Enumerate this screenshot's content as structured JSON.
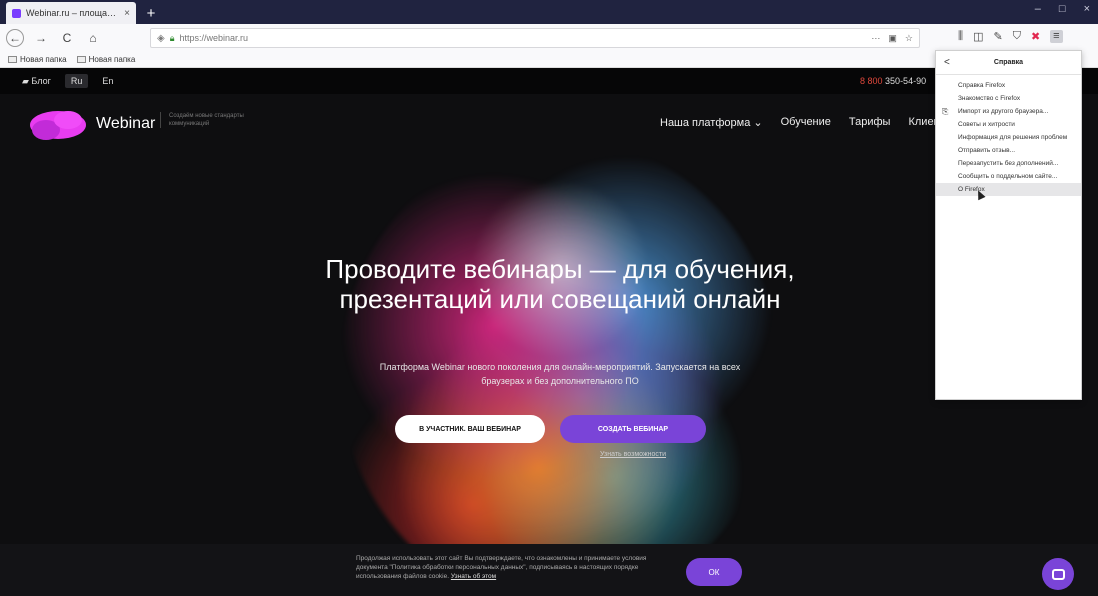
{
  "browser": {
    "tab_title": "Webinar.ru – площадка для с",
    "tab_close": "×",
    "newtab": "+",
    "window_controls": [
      "–",
      "□",
      "×"
    ],
    "nav": {
      "back": "←",
      "forward": "→",
      "reload": "C",
      "home": "⌂"
    },
    "url": "https://webinar.ru",
    "url_tail": [
      "···",
      "▣",
      "☆"
    ],
    "toolbar_icons": [
      "⫼",
      "◫",
      "✎",
      "⛉",
      "✖",
      "≡"
    ],
    "bookmarks": [
      "Новая папка",
      "Новая папка"
    ]
  },
  "site": {
    "topstrip": {
      "blog": "Блог",
      "lang_ru": "Ru",
      "lang_en": "En",
      "phone_prefix": "8 800",
      "phone_number": "350-54-90"
    },
    "brand": "Webinar",
    "tagline": "Создаём новые стандарты коммуникаций",
    "nav": [
      "Наша платформа ⌄",
      "Обучение",
      "Тарифы",
      "Клиенты"
    ],
    "hero_title": "Проводите вебинары — для обучения, презентаций или совещаний онлайн",
    "hero_subtitle": "Платформа Webinar нового поколения для онлайн-мероприятий. Запускается на всех браузерах и без дополнительного ПО",
    "btn_join": "В УЧАСТНИК. ВАШ ВЕБИНАР",
    "btn_create": "СОЗДАТЬ ВЕБИНАР",
    "more_link": "Узнать возможности",
    "cookie_text": "Продолжая использовать этот сайт Вы подтверждаете, что ознакомлены и принимаете условия документа \"Политика обработки персональных данных\", подписываясь в настоящих порядке использования файлов cookie.",
    "cookie_link": "Узнать об этом",
    "ok": "ОК"
  },
  "help_menu": {
    "back": "<",
    "title": "Справка",
    "items": [
      "Справка Firefox",
      "Знакомство с Firefox",
      "Импорт из другого браузера...",
      "Советы и хитрости",
      "Информация для решения проблем",
      "Отправить отзыв...",
      "Перезапустить без дополнений...",
      "Сообщить о поддельном сайте...",
      "О Firefox"
    ],
    "hovered_index": 8,
    "import_icon": "⎘"
  },
  "colors": {
    "accent": "#7a44d8",
    "logo": "#e83cf0",
    "tabstrip": "#202340"
  }
}
